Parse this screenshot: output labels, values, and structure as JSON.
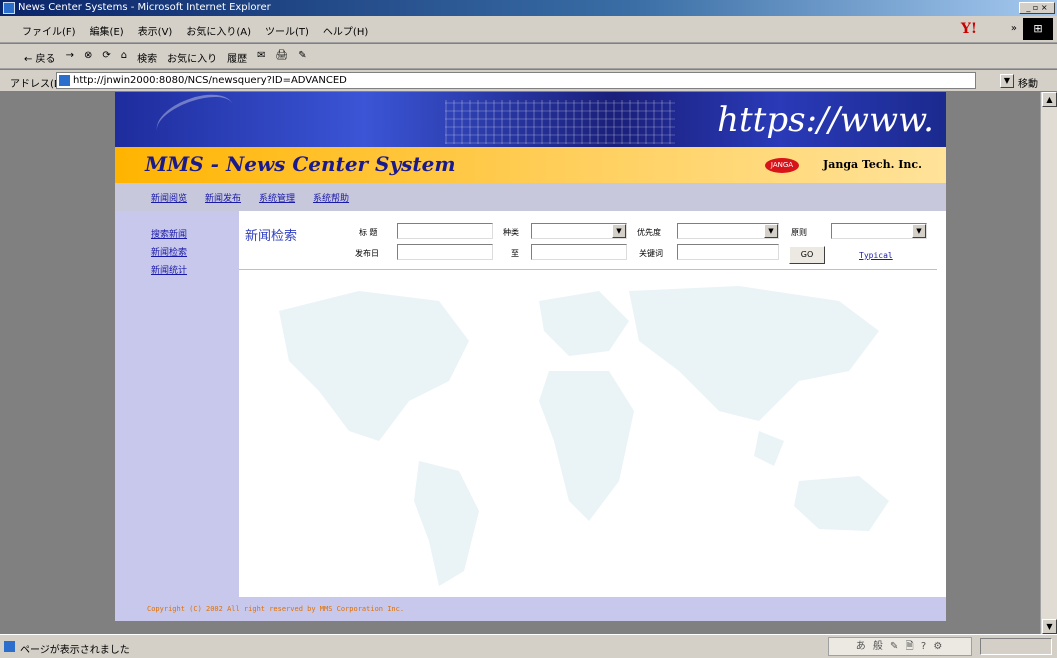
{
  "window": {
    "title": "News Center Systems - Microsoft Internet Explorer",
    "controls": "_ ▫ ×"
  },
  "menubar": {
    "items": [
      "ファイル(F)",
      "編集(E)",
      "表示(V)",
      "お気に入り(A)",
      "ツール(T)",
      "ヘルプ(H)"
    ],
    "yahoo": "Y!",
    "more": "»"
  },
  "toolbar": {
    "items": [
      "← 戻る",
      "→",
      "⊗",
      "⟳",
      "⌂",
      "検索",
      "お気に入り",
      "履歴",
      "✉",
      "🖨",
      "✎"
    ]
  },
  "address": {
    "label": "アドレス(D)",
    "url": "http://jnwin2000:8080/NCS/newsquery?ID=ADVANCED",
    "go": "移動"
  },
  "site": {
    "banner_text": "https://www.",
    "title": "MMS - News Center System",
    "logo_text": "JANGA",
    "company": "Janga Tech. Inc.",
    "nav": [
      "新闻阅览",
      "新闻发布",
      "系统管理",
      "系统帮助"
    ],
    "left_nav": [
      "搜索新闻",
      "新闻检索",
      "新闻统计"
    ],
    "footer": "Copyright (C) 2002 All right reserved by MMS Corporation Inc."
  },
  "search": {
    "heading": "新闻检索",
    "fields": {
      "title_label": "标  题",
      "title_value": "",
      "publish_date_label": "发布日",
      "publish_date_value": "",
      "category_label": "种类",
      "category_value": "",
      "to_label": "至",
      "to_value": "",
      "priority_label": "优先度",
      "priority_value": "",
      "keyword_label": "关键词",
      "keyword_value": "",
      "rule_label": "原则",
      "rule_value": ""
    },
    "go_label": "GO",
    "typical_link": "Typical"
  },
  "status": {
    "text": "ページが表示されました",
    "ime": "あ 般 ✎ 🗎 ? ⚙"
  },
  "colors": {
    "banner": "#1e2c9c",
    "brand_bar": "#ffb400",
    "nav_bg": "#c8c8dc",
    "link": "#1a1aa8",
    "footer_text": "#e07000"
  }
}
